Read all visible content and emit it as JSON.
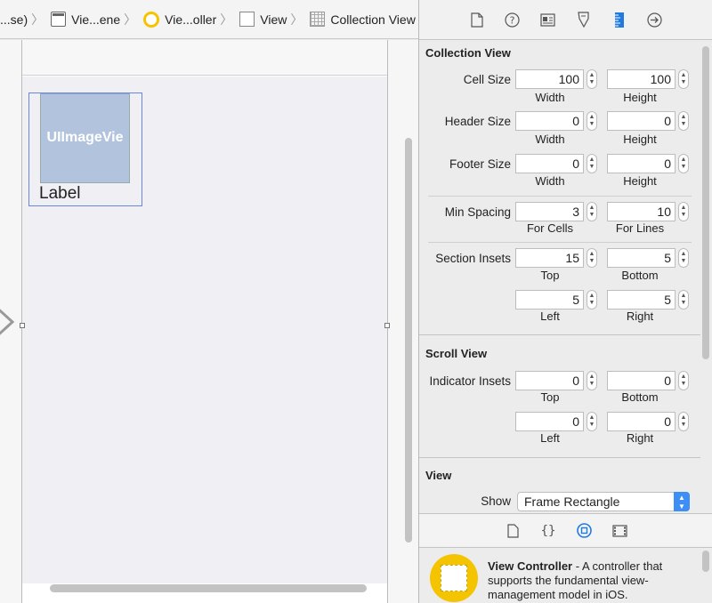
{
  "breadcrumbs": [
    {
      "label": "...se)",
      "icon": "none"
    },
    {
      "label": "Vie...ene",
      "icon": "scene-icon"
    },
    {
      "label": "Vie...oller",
      "icon": "view-controller-icon"
    },
    {
      "label": "View",
      "icon": "view-icon"
    },
    {
      "label": "Collection View",
      "icon": "collection-view-icon"
    }
  ],
  "canvas": {
    "image_view_label": "UIImageVie",
    "cell_label": "Label"
  },
  "inspector_tabs": [
    "file-inspector-icon",
    "help-icon",
    "identity-inspector-icon",
    "attributes-inspector-icon",
    "size-inspector-icon",
    "connections-inspector-icon"
  ],
  "collection_view": {
    "title": "Collection View",
    "cell_size": {
      "label": "Cell Size",
      "a": "100",
      "b": "100",
      "a_label": "Width",
      "b_label": "Height"
    },
    "header_size": {
      "label": "Header Size",
      "a": "0",
      "b": "0",
      "a_label": "Width",
      "b_label": "Height"
    },
    "footer_size": {
      "label": "Footer Size",
      "a": "0",
      "b": "0",
      "a_label": "Width",
      "b_label": "Height"
    },
    "min_spacing": {
      "label": "Min Spacing",
      "a": "3",
      "b": "10",
      "a_label": "For Cells",
      "b_label": "For Lines"
    },
    "section_insets": {
      "label": "Section Insets",
      "top": "15",
      "bottom": "5",
      "left": "5",
      "right": "5",
      "top_label": "Top",
      "bottom_label": "Bottom",
      "left_label": "Left",
      "right_label": "Right"
    }
  },
  "scroll_view": {
    "title": "Scroll View",
    "indicator_insets": {
      "label": "Indicator Insets",
      "top": "0",
      "bottom": "0",
      "left": "0",
      "right": "0",
      "top_label": "Top",
      "bottom_label": "Bottom",
      "left_label": "Left",
      "right_label": "Right"
    }
  },
  "view": {
    "title": "View",
    "show_label": "Show",
    "show_value": "Frame Rectangle"
  },
  "library": {
    "title": "View Controller",
    "description": " - A controller that supports the fundamental view-management model in iOS."
  },
  "colors": {
    "accent": "#3d8ff5",
    "vc_yellow": "#f5c400",
    "image_view": "#b2c4dd",
    "selection": "#6b86e0"
  }
}
